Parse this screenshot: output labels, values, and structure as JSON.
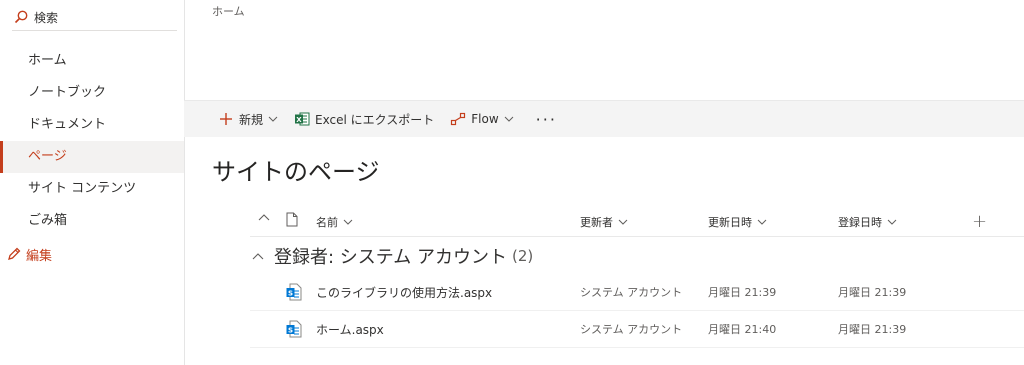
{
  "search": {
    "label": "検索"
  },
  "nav": {
    "items": [
      {
        "label": "ホーム"
      },
      {
        "label": "ノートブック"
      },
      {
        "label": "ドキュメント"
      },
      {
        "label": "ページ",
        "selected": true
      },
      {
        "label": "サイト コンテンツ"
      },
      {
        "label": "ごみ箱"
      }
    ],
    "edit_label": "編集"
  },
  "breadcrumb": "ホーム",
  "commandbar": {
    "new_label": "新規",
    "excel_label": "Excel にエクスポート",
    "flow_label": "Flow",
    "more_label": "···"
  },
  "page_title": "サイトのページ",
  "list": {
    "columns": {
      "name": "名前",
      "editor": "更新者",
      "modified": "更新日時",
      "created": "登録日時",
      "add": "+"
    },
    "group": {
      "label": "登録者: システム アカウント",
      "count": "(2)"
    },
    "rows": [
      {
        "name": "このライブラリの使用方法.aspx",
        "editor": "システム アカウント",
        "modified": "月曜日 21:39",
        "created": "月曜日 21:39"
      },
      {
        "name": "ホーム.aspx",
        "editor": "システム アカウント",
        "modified": "月曜日 21:40",
        "created": "月曜日 21:39"
      }
    ]
  },
  "colors": {
    "accent": "#c43e1c",
    "excel": "#217346",
    "sharepoint": "#0078d4",
    "commandbar_bg": "#f4f4f4"
  },
  "icons": [
    "search-icon",
    "pencil-icon",
    "plus-icon",
    "excel-icon",
    "flow-icon",
    "chevron-down-icon",
    "chevron-up-icon",
    "file-icon",
    "sharepoint-page-icon"
  ]
}
